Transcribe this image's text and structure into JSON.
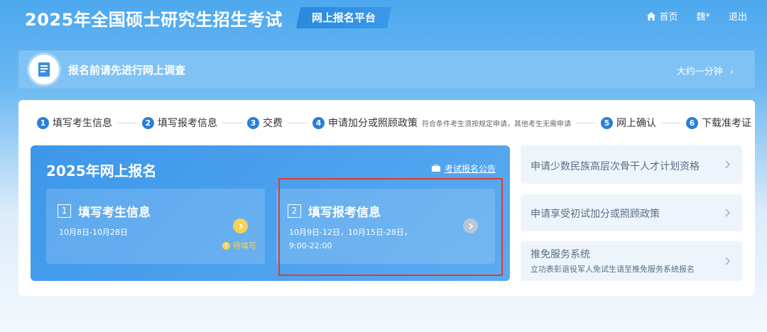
{
  "header": {
    "title": "2025年全国硕士研究生招生考试",
    "platform": "网上报名平台",
    "nav": {
      "home": "首页",
      "user": "魏*",
      "logout": "退出"
    }
  },
  "survey": {
    "text": "报名前请先进行网上调查",
    "time": "大约一分钟"
  },
  "steps": [
    {
      "num": "1",
      "label": "填写考生信息"
    },
    {
      "num": "2",
      "label": "填写报考信息"
    },
    {
      "num": "3",
      "label": "交费"
    },
    {
      "num": "4",
      "label": "申请加分或照顾政策",
      "note": "符合条件考生须按规定申请，其他考生无需申请"
    },
    {
      "num": "5",
      "label": "网上确认"
    },
    {
      "num": "6",
      "label": "下载准考证"
    }
  ],
  "panel": {
    "title": "2025年网上报名",
    "notice": "考试报名公告",
    "box1": {
      "num": "1",
      "title": "填写考生信息",
      "date": "10月8日-10月28日",
      "status": "待填写"
    },
    "box2": {
      "num": "2",
      "title": "填写报考信息",
      "date": "10月9日-12日，10月15日-28日，",
      "time": "9:00-22:00"
    }
  },
  "side": {
    "item1": "申请少数民族高层次骨干人才计划资格",
    "item2": "申请享受初试加分或照顾政策",
    "item3": "推免服务系统",
    "item3_sub": "立功表彰退役军人免试生请至推免服务系统报名"
  },
  "colors": {
    "accent": "#2a7fd8",
    "highlight": "#e23a2e",
    "pending": "#f7d354"
  },
  "icons": [
    "home-icon",
    "survey-document-icon",
    "briefcase-icon",
    "arrow-right-icon",
    "chevron-right-icon",
    "info-icon"
  ]
}
